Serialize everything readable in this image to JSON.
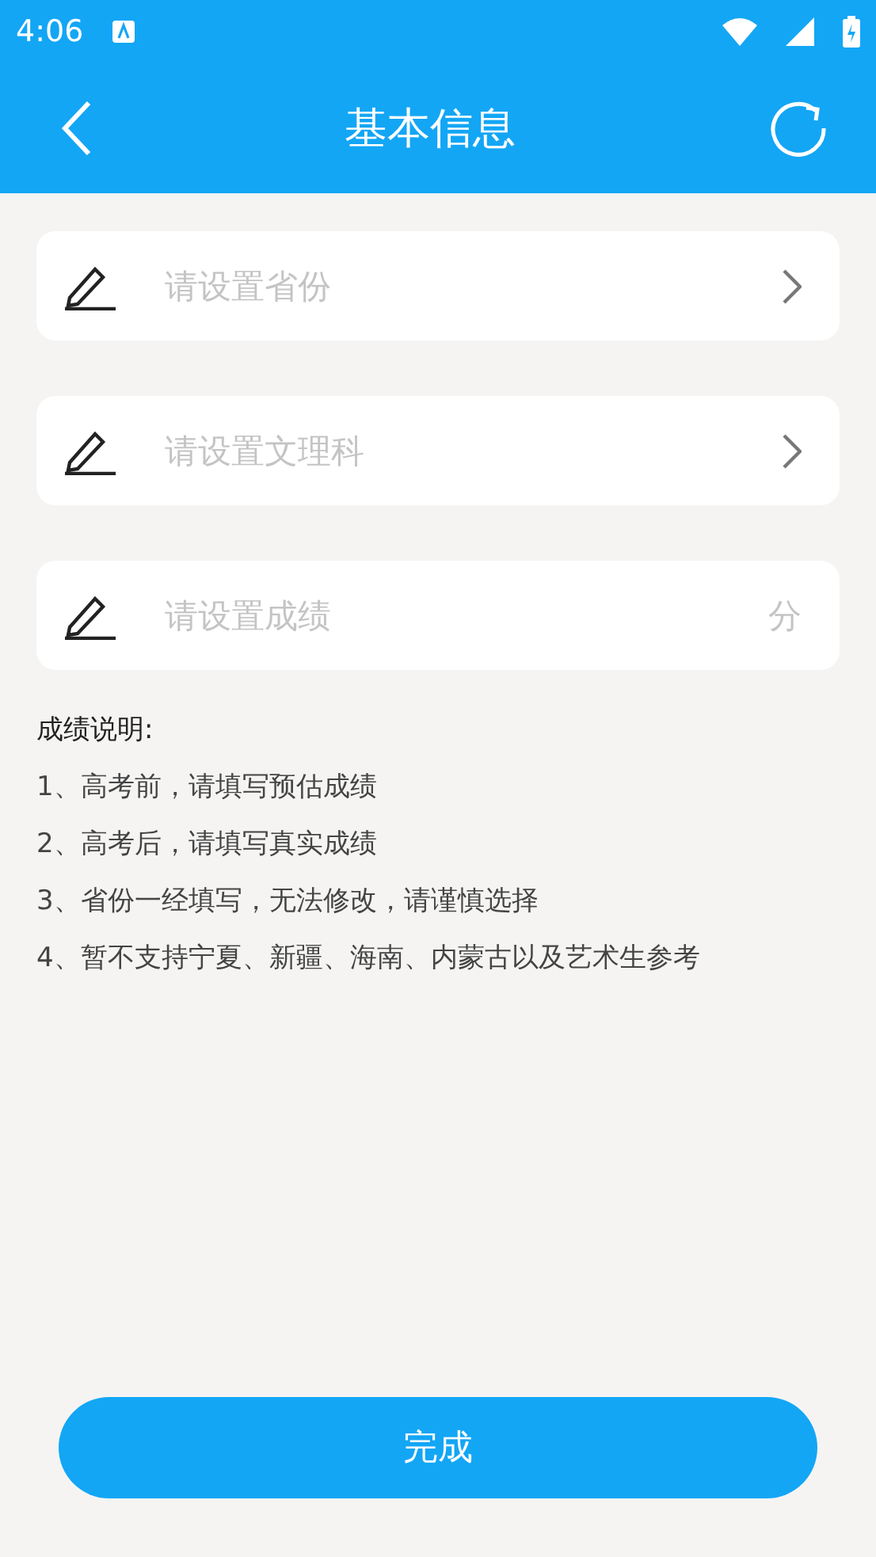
{
  "status_bar": {
    "time": "4:06"
  },
  "header": {
    "title": "基本信息"
  },
  "fields": [
    {
      "kind": "select",
      "placeholder": "请设置省份"
    },
    {
      "kind": "select",
      "placeholder": "请设置文理科"
    },
    {
      "kind": "score",
      "placeholder": "请设置成绩",
      "unit": "分"
    }
  ],
  "notes": {
    "title": "成绩说明:",
    "items": [
      "1、高考前，请填写预估成绩",
      "2、高考后，请填写真实成绩",
      "3、省份一经填写，无法修改，请谨慎选择",
      "4、暂不支持宁夏、新疆、海南、内蒙古以及艺术生参考"
    ]
  },
  "submit_button": "完成"
}
